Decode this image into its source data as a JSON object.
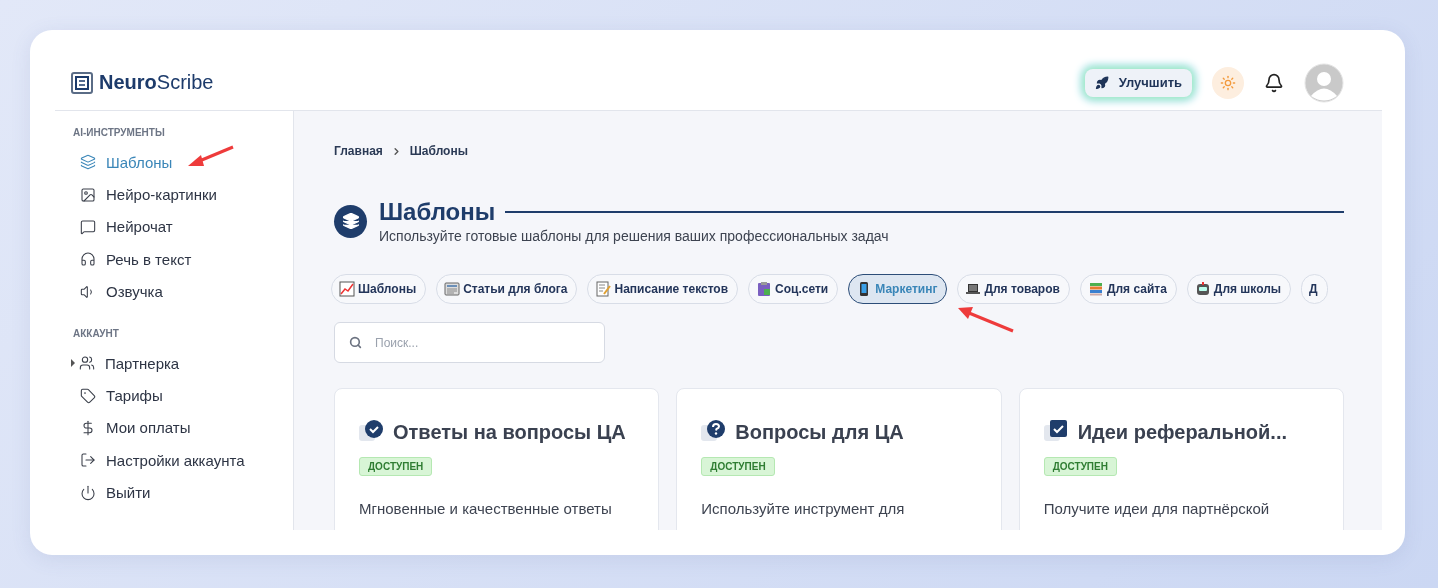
{
  "header": {
    "logo": {
      "bold": "Neuro",
      "light": "Scribe"
    },
    "upgrade_button": "Улучшить"
  },
  "sidebar": {
    "sections": [
      {
        "title": "AI-ИНСТРУМЕНТЫ",
        "items": [
          {
            "label": "Шаблоны",
            "selected": true,
            "expandable": false
          },
          {
            "label": "Нейро-картинки",
            "selected": false,
            "expandable": false
          },
          {
            "label": "Нейрочат",
            "selected": false,
            "expandable": false
          },
          {
            "label": "Речь в текст",
            "selected": false,
            "expandable": false
          },
          {
            "label": "Озвучка",
            "selected": false,
            "expandable": false
          }
        ]
      },
      {
        "title": "АККАУНТ",
        "items": [
          {
            "label": "Партнерка",
            "selected": false,
            "expandable": true
          },
          {
            "label": "Тарифы",
            "selected": false,
            "expandable": false
          },
          {
            "label": "Мои оплаты",
            "selected": false,
            "expandable": false
          },
          {
            "label": "Настройки аккаунта",
            "selected": false,
            "expandable": false
          },
          {
            "label": "Выйти",
            "selected": false,
            "expandable": false
          }
        ]
      }
    ]
  },
  "breadcrumb": [
    "Главная",
    "Шаблоны"
  ],
  "page": {
    "title": "Шаблоны",
    "subtitle": "Используйте готовые шаблоны для решения ваших профессиональных задач"
  },
  "categories": [
    {
      "label": "Шаблоны",
      "selected": false
    },
    {
      "label": "Статьи для блога",
      "selected": false
    },
    {
      "label": "Написание текстов",
      "selected": false
    },
    {
      "label": "Соц.сети",
      "selected": false
    },
    {
      "label": "Маркетинг",
      "selected": true
    },
    {
      "label": "Для товаров",
      "selected": false
    },
    {
      "label": "Для сайта",
      "selected": false
    },
    {
      "label": "Для школы",
      "selected": false
    },
    {
      "label": "Д",
      "selected": false
    }
  ],
  "search": {
    "placeholder": "Поиск..."
  },
  "cards": [
    {
      "title": "Ответы на вопросы ЦА",
      "badge": "ДОСТУПЕН",
      "description": "Мгновенные и качественные ответы"
    },
    {
      "title": "Вопросы для ЦА",
      "badge": "ДОСТУПЕН",
      "description": "Используйте инструмент для"
    },
    {
      "title": "Идеи реферальной...",
      "badge": "ДОСТУПЕН",
      "description": "Получите идеи для партнёрской"
    }
  ]
}
